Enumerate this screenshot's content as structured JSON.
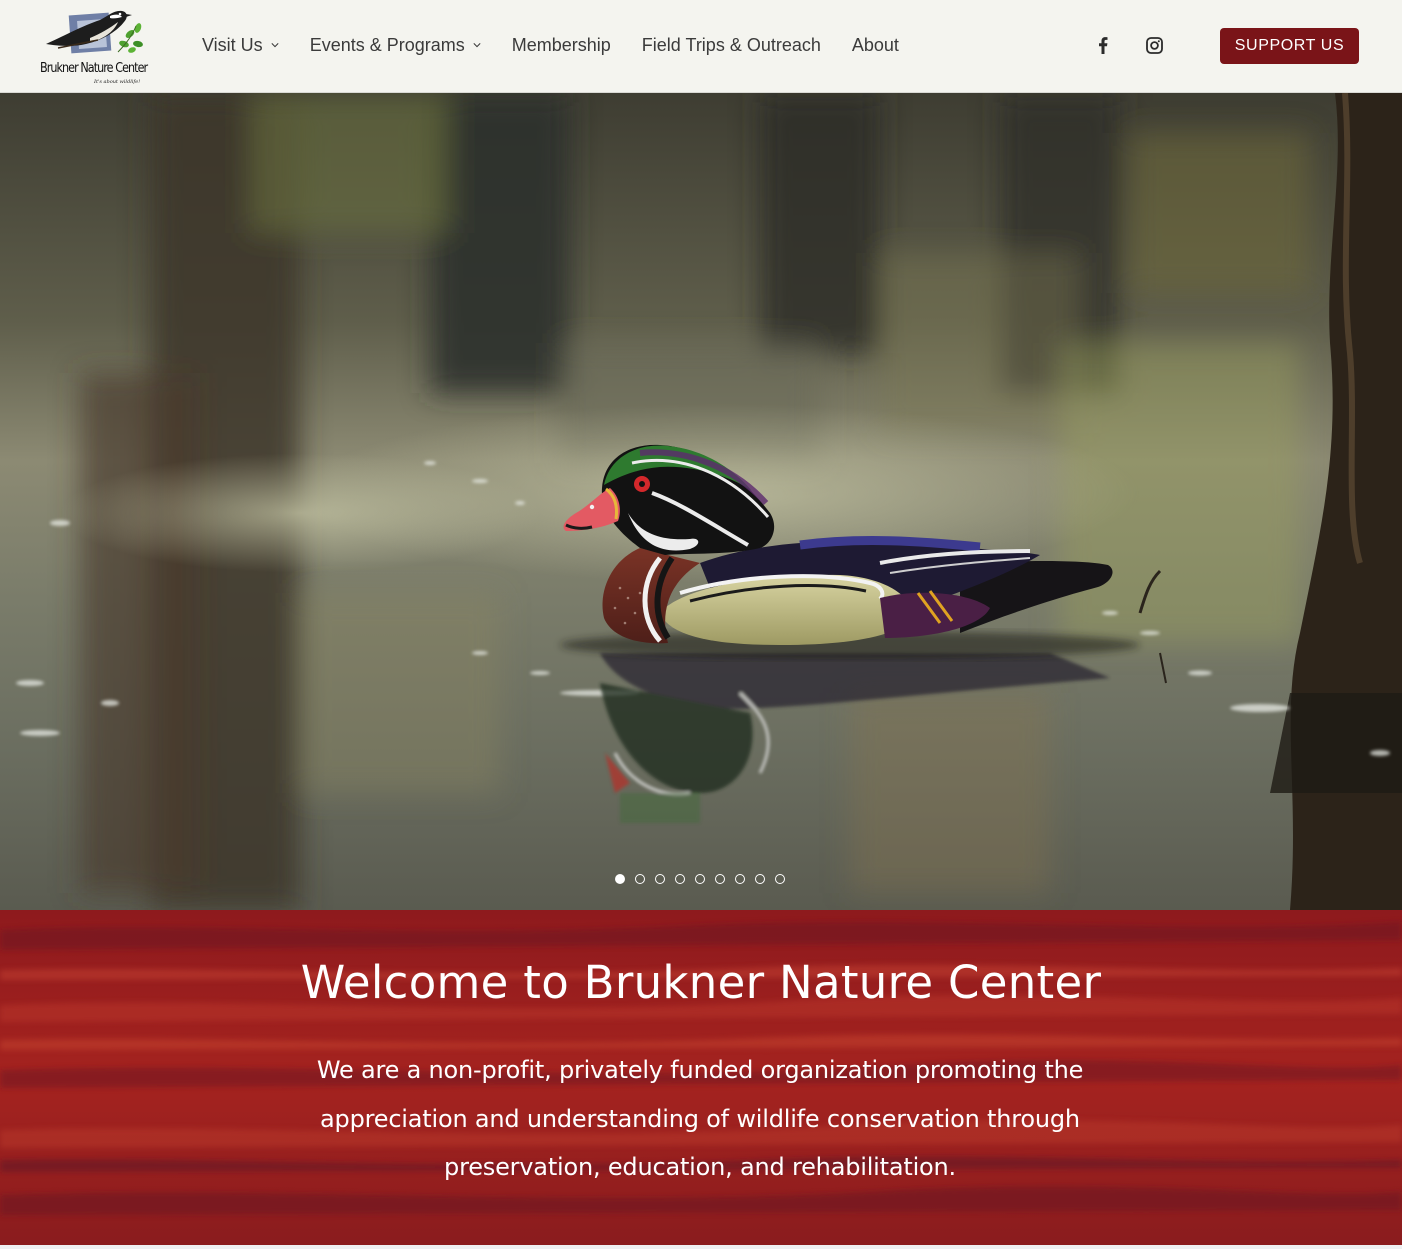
{
  "header": {
    "logo": {
      "name": "Brukner Nature Center",
      "tagline": "It's about wildlife!"
    },
    "nav": [
      {
        "label": "Visit Us",
        "has_dropdown": true
      },
      {
        "label": "Events & Programs",
        "has_dropdown": true
      },
      {
        "label": "Membership",
        "has_dropdown": false
      },
      {
        "label": "Field Trips & Outreach",
        "has_dropdown": false
      },
      {
        "label": "About",
        "has_dropdown": false
      }
    ],
    "social": [
      {
        "icon": "facebook-icon"
      },
      {
        "icon": "instagram-icon"
      }
    ],
    "support_label": "SUPPORT US"
  },
  "hero": {
    "image": "wood duck swimming on reflective pond",
    "slide_count": 9,
    "active_slide": 1
  },
  "welcome": {
    "title": "Welcome to Brukner Nature Center",
    "text": "We are a non-profit, privately funded organization promoting the appreciation and understanding of wildlife conservation through preservation, education, and rehabilitation."
  },
  "colors": {
    "header_bg": "#f4f4ef",
    "accent": "#7a1418",
    "welcome_bg": "#9c1f1c",
    "nav_text": "#3b3b3b"
  }
}
